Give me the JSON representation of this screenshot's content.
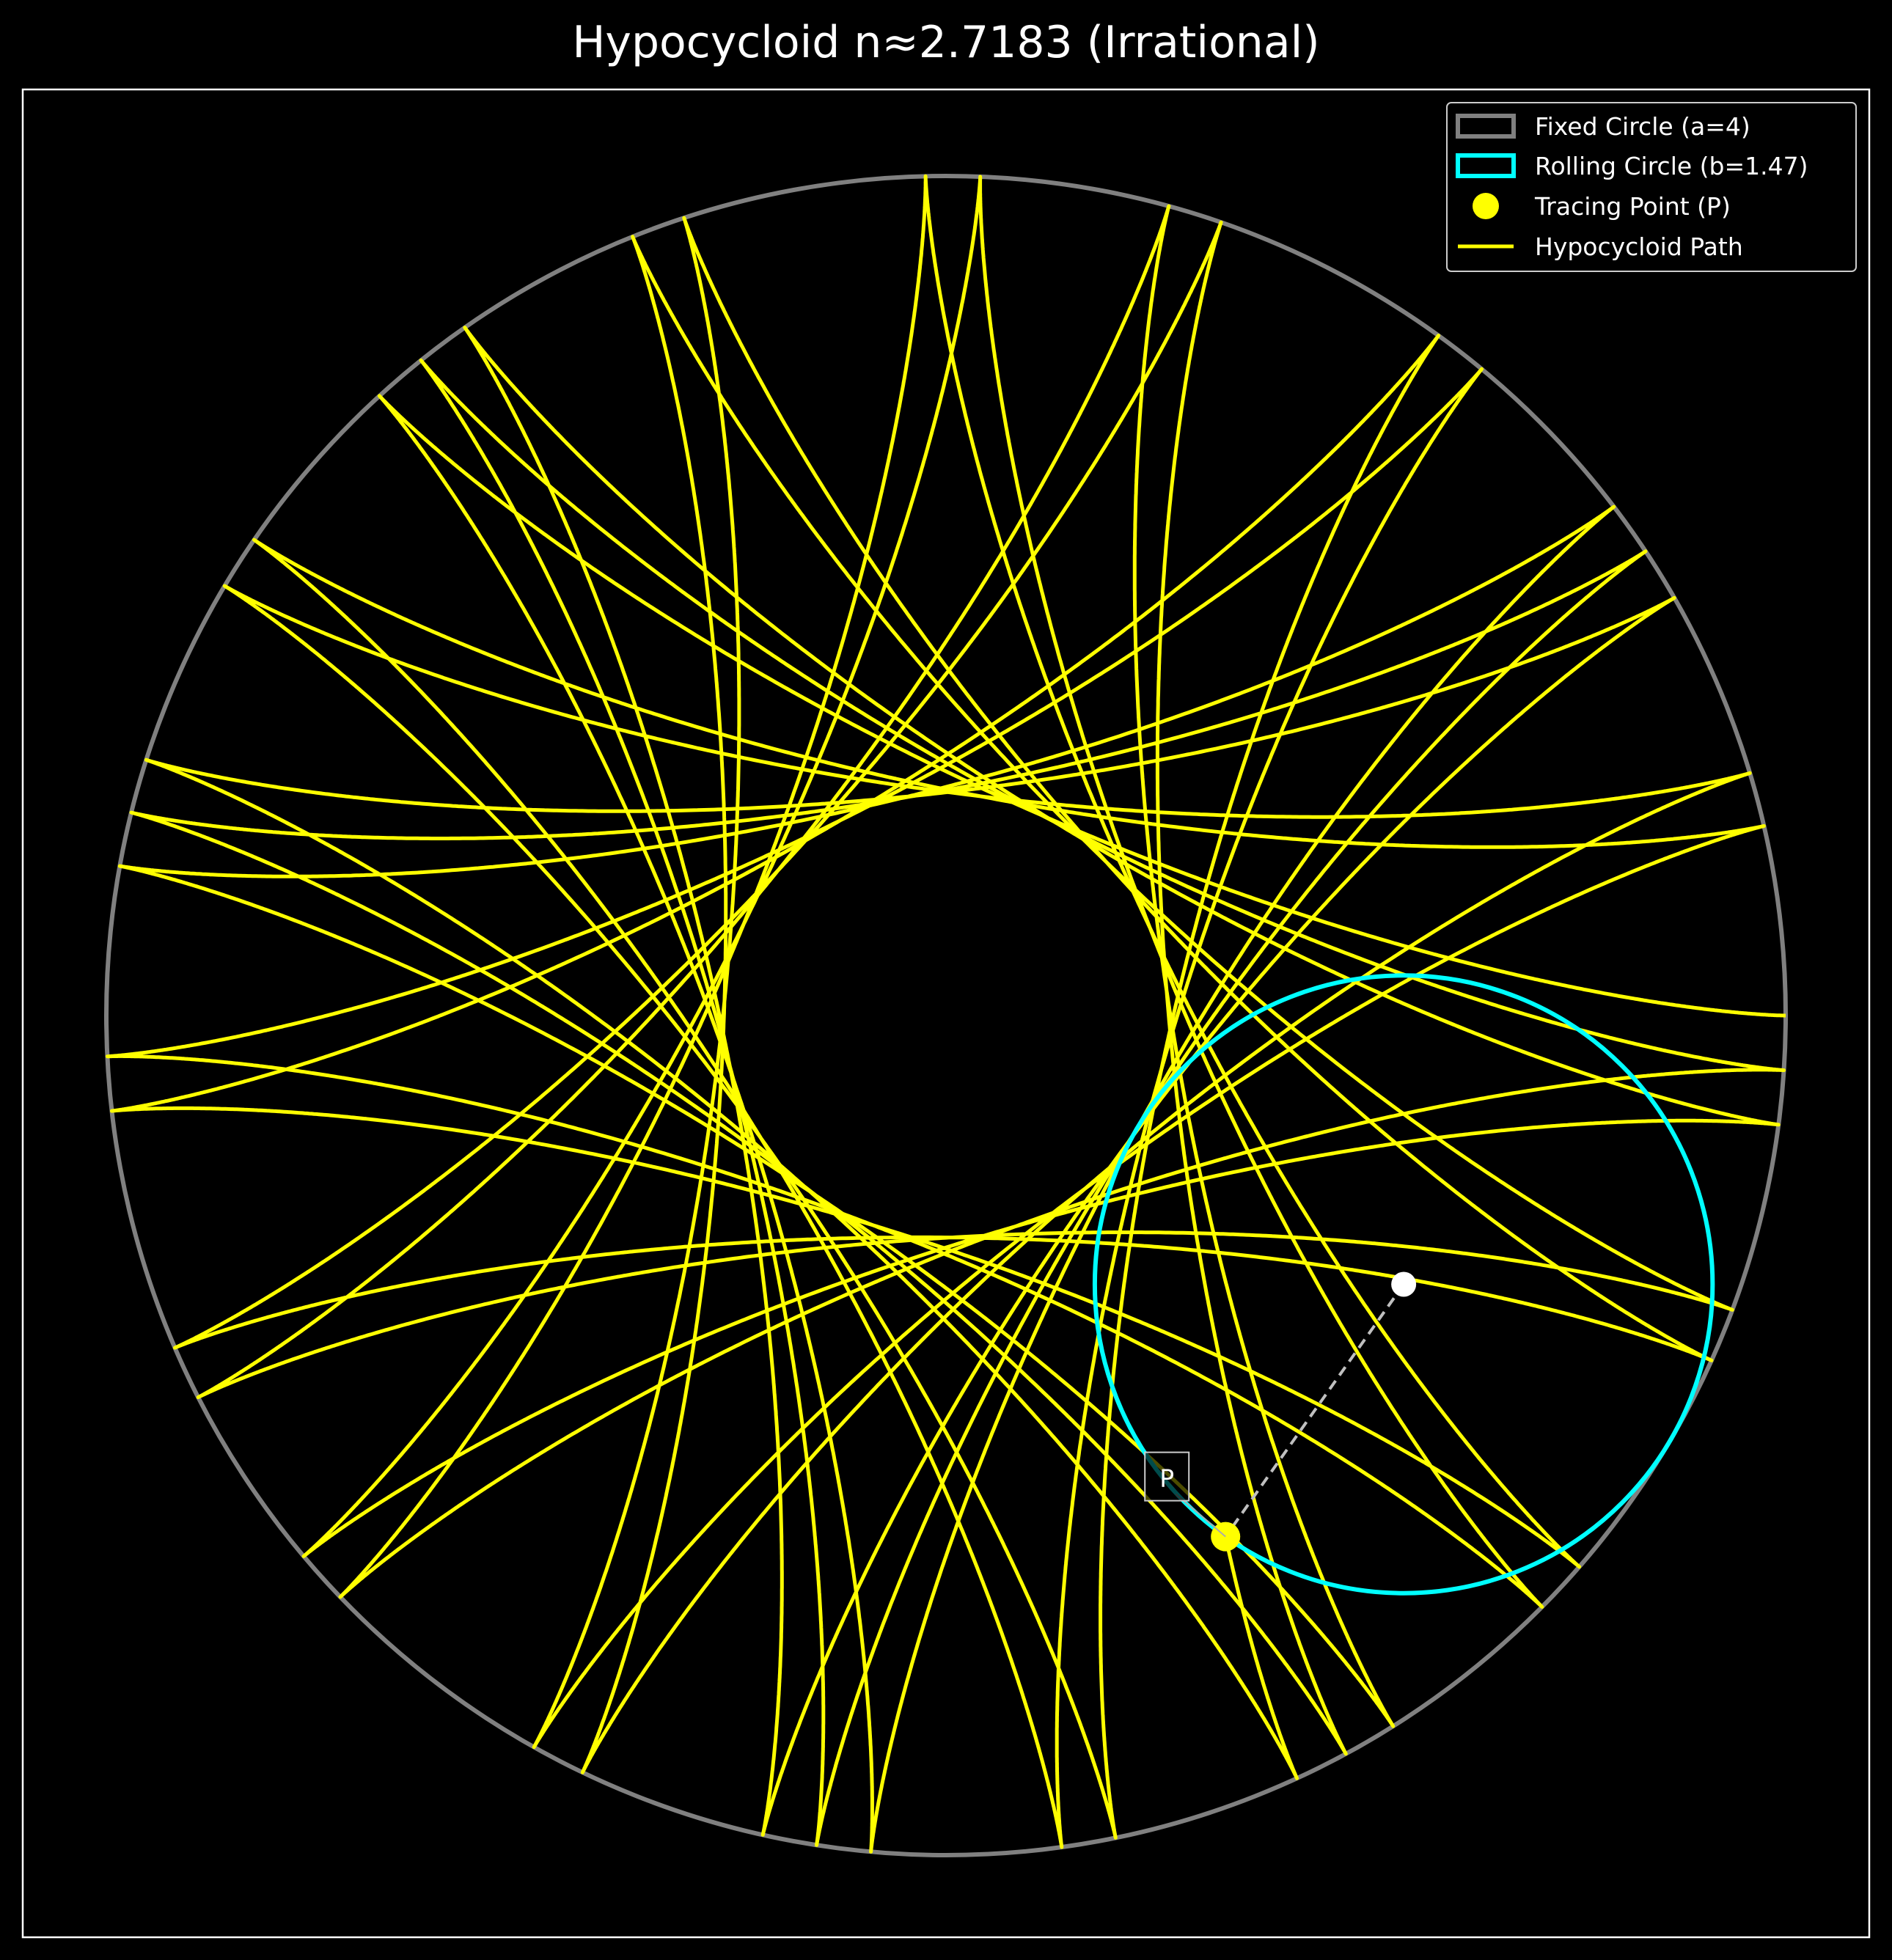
{
  "title": "Hypocycloid n≈2.7183 (Irrational)",
  "colors": {
    "background": "#000000",
    "fixed_circle": "#808080",
    "rolling_circle": "#00ffff",
    "path": "#ffff00",
    "tracing_point": "#ffff00",
    "center_point": "#ffffff",
    "spoke": "#c0c0c0"
  },
  "legend": {
    "fixed_circle": "Fixed Circle (a=4)",
    "rolling_circle": "Rolling Circle (b=1.47)",
    "tracing_point": "Tracing Point (P)",
    "path": "Hypocycloid Path"
  },
  "point_label": "P",
  "chart_data": {
    "type": "parametric-curve",
    "fixed_radius": 4,
    "rolling_radius": 1.4715,
    "ratio_n": 2.7183,
    "t_range": [
      0,
      100
    ],
    "current_t": 100,
    "axes_visible": false,
    "aspect": "equal",
    "legend_position": "upper right"
  }
}
